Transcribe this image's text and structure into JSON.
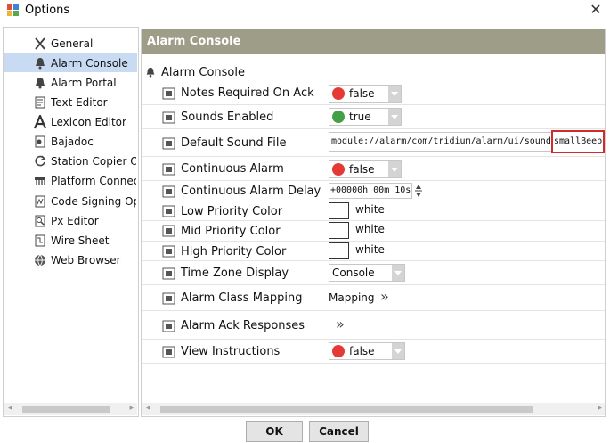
{
  "window": {
    "title": "Options"
  },
  "sidebar": {
    "items": [
      {
        "label": "General",
        "icon": "general-icon"
      },
      {
        "label": "Alarm Console",
        "icon": "bell-icon",
        "selected": true
      },
      {
        "label": "Alarm Portal",
        "icon": "bell-icon"
      },
      {
        "label": "Text Editor",
        "icon": "text-editor-icon"
      },
      {
        "label": "Lexicon Editor",
        "icon": "lexicon-icon"
      },
      {
        "label": "Bajadoc",
        "icon": "bajadoc-icon"
      },
      {
        "label": "Station Copier Opt",
        "icon": "refresh-icon"
      },
      {
        "label": "Platform Connecti",
        "icon": "platform-icon"
      },
      {
        "label": "Code Signing Opti",
        "icon": "code-signing-icon"
      },
      {
        "label": "Px Editor",
        "icon": "px-editor-icon"
      },
      {
        "label": "Wire Sheet",
        "icon": "wire-sheet-icon"
      },
      {
        "label": "Web Browser",
        "icon": "globe-icon"
      }
    ]
  },
  "panel": {
    "header": "Alarm Console",
    "section_label": "Alarm Console",
    "rows": {
      "notes_required": {
        "label": "Notes Required On Ack",
        "value": "false",
        "status_color": "#e53935"
      },
      "sounds_enabled": {
        "label": "Sounds Enabled",
        "value": "true",
        "status_color": "#43a047"
      },
      "default_sound": {
        "label": "Default Sound File",
        "path": "module://alarm/com/tridium/alarm/ui/sounds/",
        "file": "smallBeep"
      },
      "continuous_alarm": {
        "label": "Continuous Alarm",
        "value": "false",
        "status_color": "#e53935"
      },
      "continuous_delay": {
        "label": "Continuous Alarm Delay",
        "value": "+00000h 00m 10s"
      },
      "low_priority_color": {
        "label": "Low Priority Color",
        "value": "white"
      },
      "mid_priority_color": {
        "label": "Mid Priority Color",
        "value": "white"
      },
      "high_priority_color": {
        "label": "High Priority Color",
        "value": "white"
      },
      "time_zone_display": {
        "label": "Time Zone Display",
        "value": "Console"
      },
      "alarm_class_mapping": {
        "label": "Alarm Class Mapping",
        "value": "Mapping"
      },
      "alarm_ack_responses": {
        "label": "Alarm Ack Responses"
      },
      "view_instructions": {
        "label": "View Instructions",
        "value": "false",
        "status_color": "#e53935"
      }
    }
  },
  "buttons": {
    "ok": "OK",
    "cancel": "Cancel"
  }
}
